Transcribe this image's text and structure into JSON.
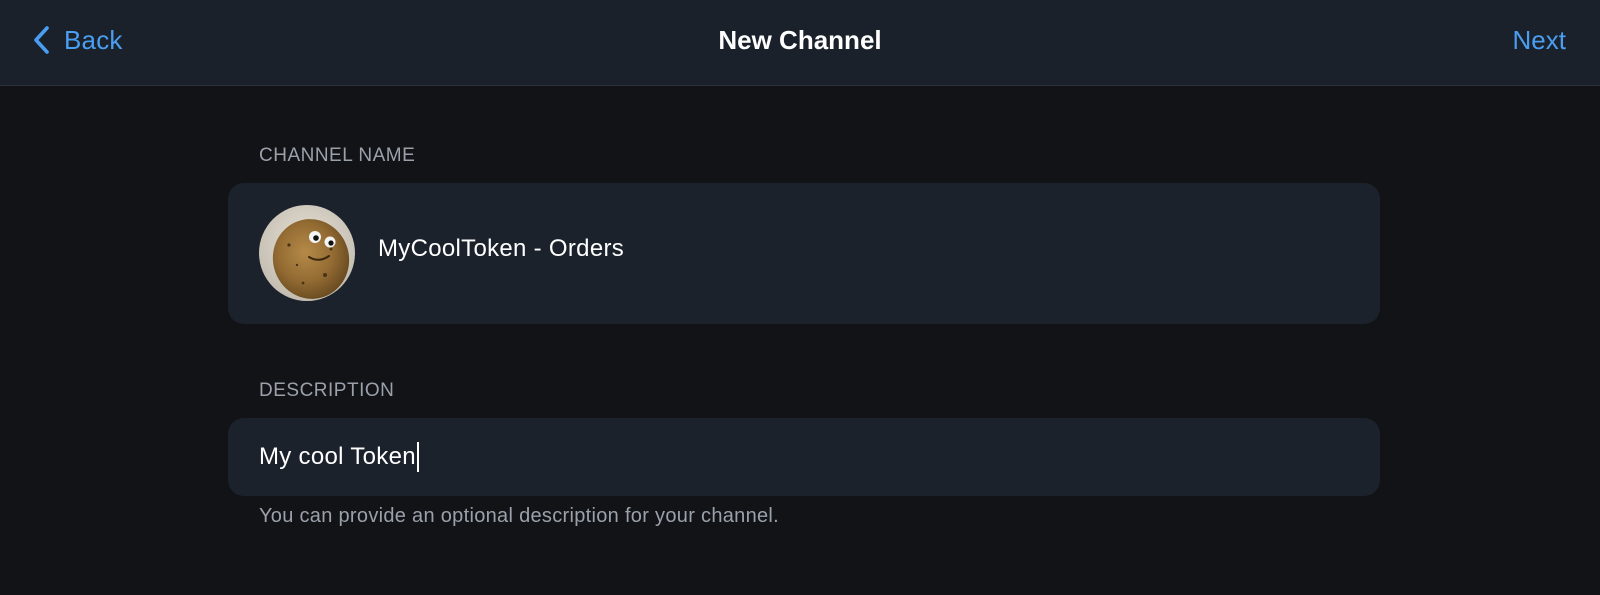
{
  "header": {
    "back_label": "Back",
    "title": "New Channel",
    "next_label": "Next"
  },
  "channel_name": {
    "section_label": "CHANNEL NAME",
    "value": "MyCoolToken - Orders"
  },
  "description": {
    "section_label": "DESCRIPTION",
    "value": "My cool Token",
    "hint": "You can provide an optional description for your channel."
  },
  "colors": {
    "accent": "#4a9ef2",
    "background": "#121316",
    "header_bg": "#1b212b",
    "card_bg": "#1c222c",
    "muted_text": "#9aa1ab"
  }
}
